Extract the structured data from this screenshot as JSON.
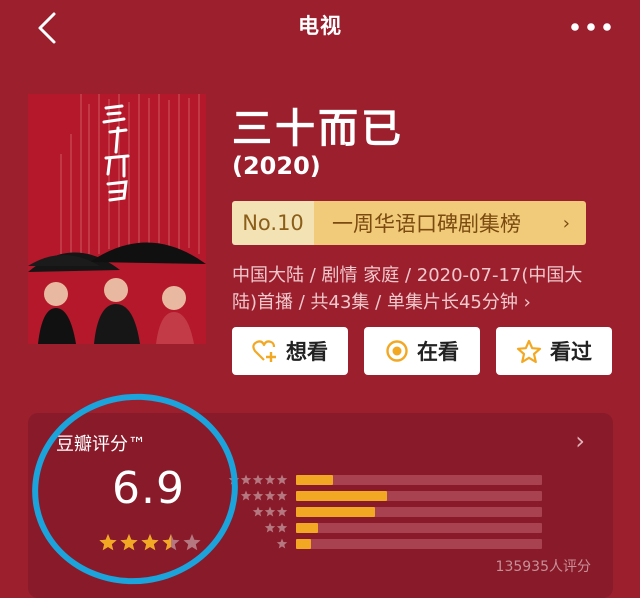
{
  "header": {
    "title": "电视",
    "back_icon": "chevron-left-icon",
    "more_icon": "more-horizontal-icon"
  },
  "show": {
    "title": "三十而已",
    "year": "(2020)",
    "poster_icon": "poster-image"
  },
  "ranking": {
    "number": "No.10",
    "list_name": "一周华语口碑剧集榜",
    "arrow": "›"
  },
  "meta": {
    "line": "中国大陆 / 剧情 家庭 / 2020-07-17(中国大陆)首播 / 共43集 / 单集片长45分钟",
    "arrow": "›"
  },
  "actions": [
    {
      "label": "想看",
      "icon": "heart-plus-icon"
    },
    {
      "label": "在看",
      "icon": "radio-dot-icon"
    },
    {
      "label": "看过",
      "icon": "star-outline-icon"
    }
  ],
  "rating": {
    "label": "豆瓣评分™",
    "arrow": "›",
    "score": "6.9",
    "score_value": 6.9,
    "stars_filled": 3.5,
    "distribution": [
      {
        "stars": 5,
        "fraction": 0.15
      },
      {
        "stars": 4,
        "fraction": 0.37
      },
      {
        "stars": 3,
        "fraction": 0.32
      },
      {
        "stars": 2,
        "fraction": 0.09
      },
      {
        "stars": 1,
        "fraction": 0.06
      }
    ],
    "count": "135935人评分"
  },
  "colors": {
    "background": "#9c1f2e",
    "panel": "#891a2a",
    "rank_badge": "#f1cb79",
    "bar": "#f3a823",
    "annotation_ring": "#1ba3dc"
  }
}
